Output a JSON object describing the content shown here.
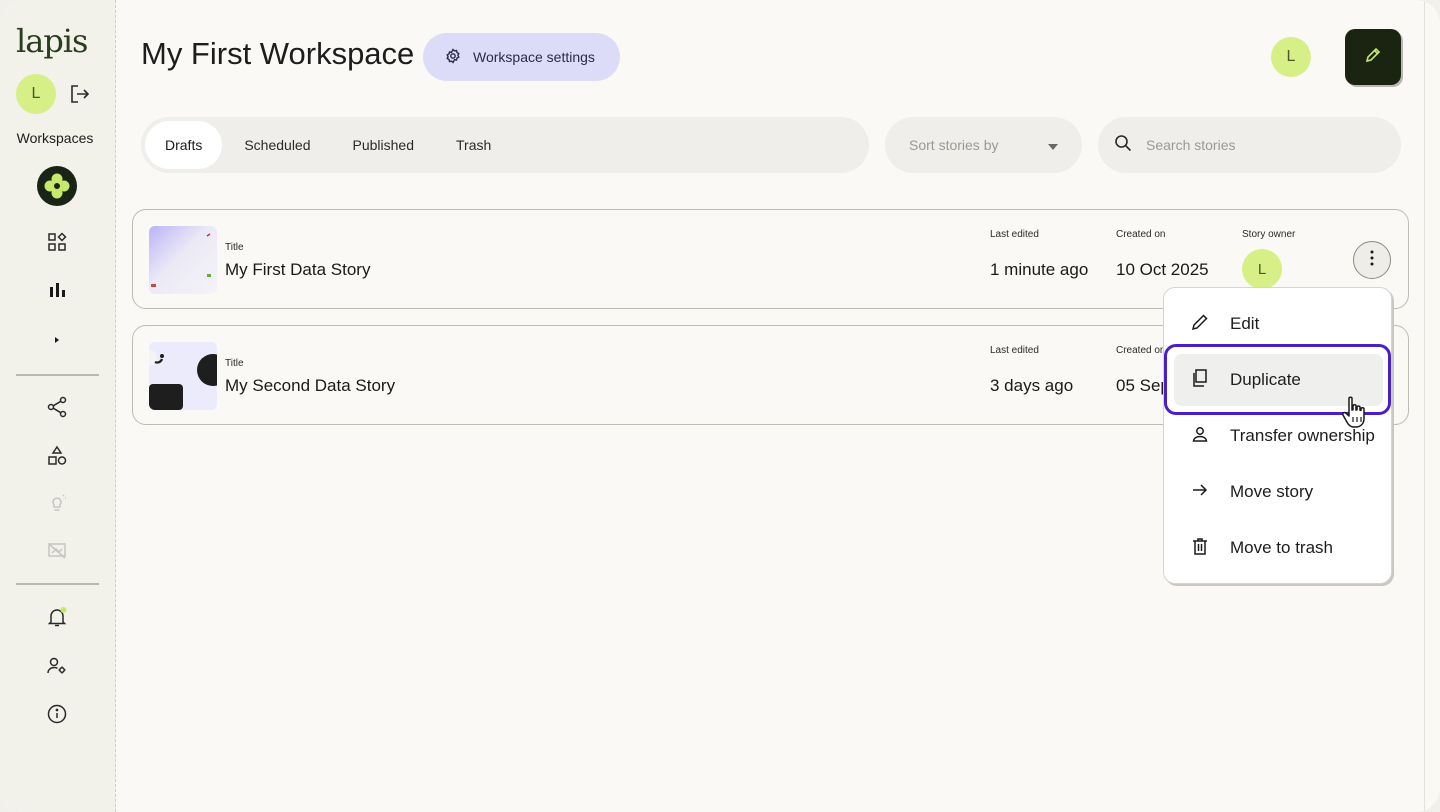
{
  "sidebar": {
    "logo": "lapis",
    "avatar_initial": "L",
    "workspaces_label": "Workspaces"
  },
  "header": {
    "title": "My First Workspace",
    "settings_label": "Workspace settings",
    "avatar_initial": "L"
  },
  "tabs": [
    "Drafts",
    "Scheduled",
    "Published",
    "Trash"
  ],
  "sort": {
    "placeholder": "Sort stories by"
  },
  "search": {
    "placeholder": "Search stories"
  },
  "columns": {
    "title": "Title",
    "last_edited": "Last edited",
    "created_on": "Created on",
    "owner": "Story owner"
  },
  "stories": [
    {
      "title": "My First Data Story",
      "last_edited": "1 minute ago",
      "created_on": "10 Oct 2025",
      "owner_initial": "L"
    },
    {
      "title": "My Second Data Story",
      "last_edited": "3 days ago",
      "created_on": "05 Sep"
    }
  ],
  "menu": {
    "items": [
      "Edit",
      "Duplicate",
      "Transfer ownership",
      "Move story",
      "Move to trash"
    ]
  },
  "colors": {
    "accent_lime": "#d6ef86",
    "highlight": "#4a1ec8",
    "settings_bg": "#dcdcf8"
  }
}
